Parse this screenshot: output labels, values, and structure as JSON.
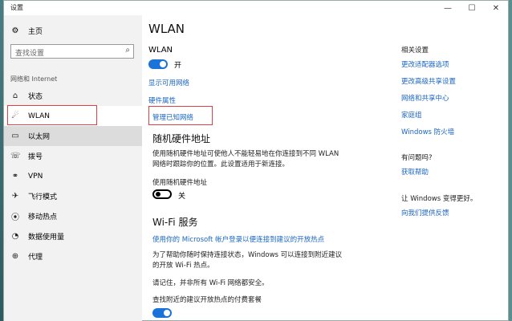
{
  "window": {
    "title": "设置",
    "minimize": "—",
    "maximize": "☐",
    "close": "✕"
  },
  "sidebar": {
    "home_label": "主页",
    "search_placeholder": "查找设置",
    "section_label": "网络和 Internet",
    "items": [
      {
        "label": "状态",
        "icon": "status-icon",
        "glyph": "⌂"
      },
      {
        "label": "WLAN",
        "icon": "wifi-icon",
        "glyph": "☄"
      },
      {
        "label": "以太网",
        "icon": "ethernet-icon",
        "glyph": "▭"
      },
      {
        "label": "拨号",
        "icon": "dialup-icon",
        "glyph": "☏"
      },
      {
        "label": "VPN",
        "icon": "vpn-icon",
        "glyph": "⚭"
      },
      {
        "label": "飞行模式",
        "icon": "airplane-icon",
        "glyph": "✈"
      },
      {
        "label": "移动热点",
        "icon": "hotspot-icon",
        "glyph": "⦿"
      },
      {
        "label": "数据使用量",
        "icon": "data-usage-icon",
        "glyph": "◔"
      },
      {
        "label": "代理",
        "icon": "proxy-icon",
        "glyph": "⊕"
      }
    ]
  },
  "main": {
    "title": "WLAN",
    "wlan_label": "WLAN",
    "wlan_toggle_state": "开",
    "link_show_networks": "显示可用网络",
    "link_hardware": "硬件属性",
    "link_manage_known": "管理已知网络",
    "random_mac_heading": "随机硬件地址",
    "random_mac_desc": "使用随机硬件地址可使他人不能轻易地在你连接到不同 WLAN 网络时跟踪你的位置。此设置适用于新连接。",
    "random_mac_label": "使用随机硬件地址",
    "random_mac_state": "关",
    "wifi_service_heading": "Wi-Fi 服务",
    "wifi_service_link": "使用你的 Microsoft 帐户登录以便连接到建议的开放热点",
    "wifi_service_desc": "为了帮助你随时保持连接状态，Windows 可以连接到附近建议的开放 Wi-Fi 热点。",
    "wifi_service_note": "请记住，并非所有 Wi-Fi 网络都安全。",
    "paid_hotspot_label": "查找附近的建议开放热点的付费套餐"
  },
  "related": {
    "title": "相关设置",
    "links": [
      "更改适配器选项",
      "更改高级共享设置",
      "网络和共享中心",
      "家庭组",
      "Windows 防火墙"
    ],
    "question_title": "有问题吗?",
    "help_link": "获取帮助",
    "feedback_title": "让 Windows 变得更好。",
    "feedback_link": "向我们提供反馈"
  },
  "colors": {
    "accent": "#1a73d9",
    "link": "#1a66c4",
    "highlight": "#e04040"
  }
}
